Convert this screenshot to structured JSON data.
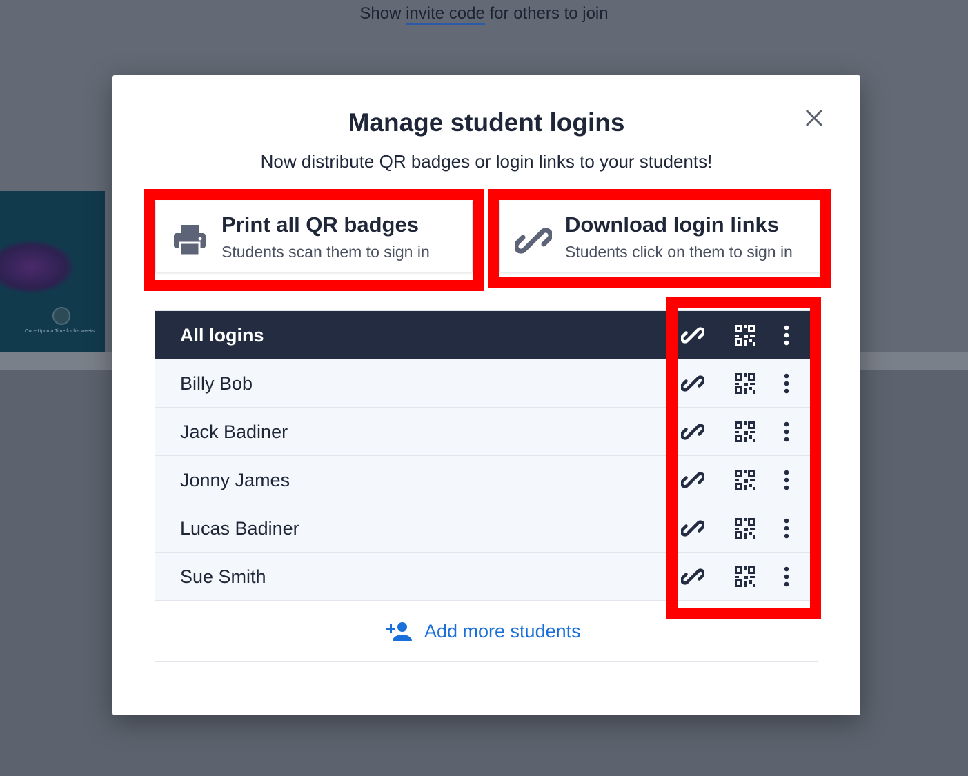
{
  "background": {
    "top_text_before": "Show",
    "top_text_link": "invite code",
    "top_text_after": "for others to join",
    "thumbnail_caption": "Once Upon a Time for his weeks"
  },
  "modal": {
    "title": "Manage student logins",
    "subtitle": "Now distribute QR badges or login links to your students!",
    "print_card": {
      "title": "Print all QR badges",
      "subtitle": "Students scan them to sign in",
      "icon": "printer-icon"
    },
    "download_card": {
      "title": "Download login links",
      "subtitle": "Students click on them to sign in",
      "icon": "link-icon"
    },
    "table": {
      "header_label": "All logins",
      "rows": [
        {
          "name": "Billy Bob"
        },
        {
          "name": "Jack Badiner"
        },
        {
          "name": "Jonny James"
        },
        {
          "name": "Lucas Badiner"
        },
        {
          "name": "Sue Smith"
        }
      ],
      "row_action_icons": [
        "link-icon",
        "qr-code-icon",
        "more-vertical-icon"
      ]
    },
    "add_more_label": "Add more students"
  },
  "colors": {
    "header_bg": "#242c41",
    "accent_blue": "#1a6fd8",
    "highlight_red": "#ff0000",
    "overlay": "#636a75"
  }
}
